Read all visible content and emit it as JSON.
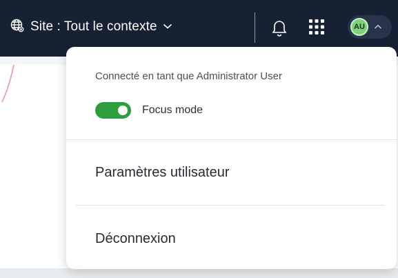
{
  "header": {
    "site_label": "Site : Tout le contexte",
    "icons": {
      "site": "globe-icon",
      "dropdown": "chevron-down-icon",
      "notifications": "bell-icon",
      "apps": "apps-grid-icon",
      "user_menu": "chevron-up-icon"
    },
    "avatar_initials": "AU"
  },
  "user_dropdown": {
    "signed_in_text": "Connecté en tant que Administrator User",
    "focus_mode": {
      "label": "Focus mode",
      "enabled": true
    },
    "items": [
      {
        "label": "Paramètres utilisateur"
      },
      {
        "label": "Déconnexion"
      }
    ]
  },
  "colors": {
    "topbar_bg": "#162133",
    "toggle_on": "#2e9d3e",
    "avatar_bg": "#7fd07a"
  }
}
